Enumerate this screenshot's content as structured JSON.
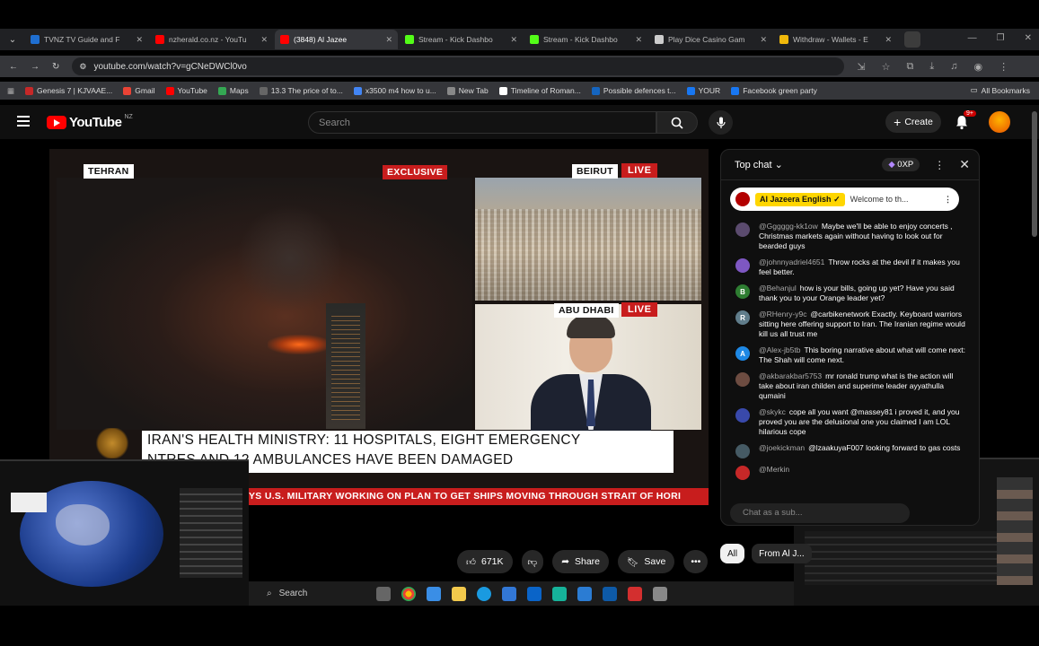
{
  "browser": {
    "tabs": [
      {
        "label": "TVNZ TV Guide and F",
        "color": "#1f6fd1",
        "active": false
      },
      {
        "label": "nzherald.co.nz - YouTu",
        "color": "#ff0000",
        "active": false
      },
      {
        "label": "(3848) Al Jazee",
        "color": "#ff0000",
        "active": true
      },
      {
        "label": "Stream - Kick Dashbo",
        "color": "#53fc18",
        "active": false
      },
      {
        "label": "Stream - Kick Dashbo",
        "color": "#53fc18",
        "active": false
      },
      {
        "label": "Play Dice Casino Gam",
        "color": "#cccccc",
        "active": false
      },
      {
        "label": "Withdraw - Wallets - E",
        "color": "#f0b90b",
        "active": false
      }
    ],
    "url": "youtube.com/watch?v=gCNeDWCl0vo",
    "bookmarks": [
      {
        "label": "Genesis 7 | KJVAAE...",
        "color": "#c62828"
      },
      {
        "label": "Gmail",
        "color": "#ea4335"
      },
      {
        "label": "YouTube",
        "color": "#ff0000"
      },
      {
        "label": "Maps",
        "color": "#34a853"
      },
      {
        "label": "13.3 The price of to...",
        "color": "#666666"
      },
      {
        "label": "x3500 m4 how to u...",
        "color": "#4285f4"
      },
      {
        "label": "New Tab",
        "color": "#888888"
      },
      {
        "label": "Timeline of Roman...",
        "color": "#ffffff"
      },
      {
        "label": "Possible defences t...",
        "color": "#1565c0"
      },
      {
        "label": "YOUR",
        "color": "#1877f2"
      },
      {
        "label": "Facebook green party",
        "color": "#1877f2"
      }
    ],
    "all_bookmarks": "All Bookmarks"
  },
  "youtube": {
    "logo": "YouTube",
    "region": "NZ",
    "search_placeholder": "Search",
    "create_label": "Create",
    "notif_count": "9+"
  },
  "video": {
    "loc_main": "TEHRAN",
    "exclusive": "EXCLUSIVE",
    "loc_right_top": "BEIRUT",
    "loc_right_bottom": "ABU DHABI",
    "live": "LIVE",
    "headline_1": "IRAN'S HEALTH MINISTRY: 11 HOSPITALS, EIGHT EMERGENCY",
    "headline_2": "NTRES AND 12 AMBULANCES HAVE BEEN DAMAGED",
    "ticker": "YS U.S. MILITARY WORKING ON PLAN TO GET SHIPS MOVING THROUGH STRAIT OF HORI"
  },
  "actions": {
    "likes": "671K",
    "share": "Share",
    "save": "Save"
  },
  "chat": {
    "header": "Top chat",
    "xp": "0XP",
    "pinned_channel": "Al Jazeera English",
    "pinned_text": "Welcome to th...",
    "messages": [
      {
        "author": "@Gggggg-kk1ow",
        "text": "Maybe we'll be able to enjoy concerts , Christmas markets again without having to look out for bearded guys",
        "color": "#5b4b6e",
        "initial": ""
      },
      {
        "author": "@johnnyadriel4651",
        "text": "Throw rocks at the devil if it makes you feel better.",
        "color": "#7e57c2",
        "initial": ""
      },
      {
        "author": "@Behanjul",
        "text": "how is your bills, going up yet? Have you said thank you to your Orange leader yet?",
        "color": "#2e7d32",
        "initial": "B"
      },
      {
        "author": "@RHenry-y9c",
        "text": "@carbikenetwork Exactly. Keyboard warriors sitting here offering support to Iran. The Iranian regime would kill us all trust me",
        "color": "#607d8b",
        "initial": "R"
      },
      {
        "author": "@Alex-jb5tb",
        "text": "This boring narrative about what will come next: The Shah will come next.",
        "color": "#1e88e5",
        "initial": "A"
      },
      {
        "author": "@akbarakbar5753",
        "text": "mr ronald trump what is the action will take about iran childen and superime leader ayyathulla qumaini",
        "color": "#6d4c41",
        "initial": ""
      },
      {
        "author": "@skykc",
        "text": "cope all you want @massey81 i proved it, and you proved you are the delusional one you claimed I am LOL hilarious cope",
        "color": "#3949ab",
        "initial": ""
      },
      {
        "author": "@joekickman",
        "text": "@lzaakuyaF007 looking forward to gas costs",
        "color": "#455a64",
        "initial": ""
      },
      {
        "author": "@Merkin",
        "text": "",
        "color": "#c62828",
        "initial": ""
      }
    ],
    "input_placeholder": "Chat as a sub...",
    "chips": [
      "All",
      "From Al J..."
    ]
  },
  "taskbar": {
    "search_label": "Search"
  }
}
